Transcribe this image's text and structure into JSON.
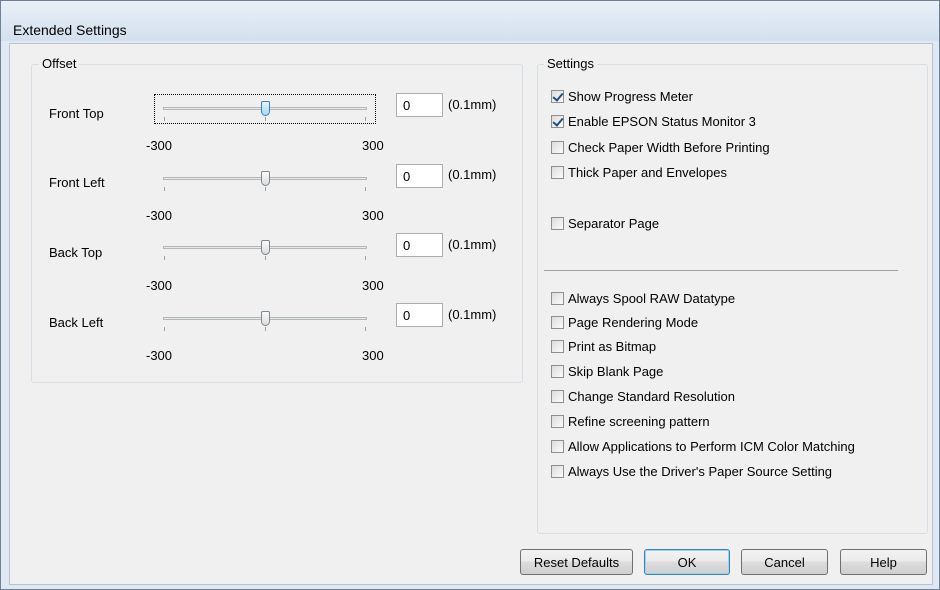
{
  "window": {
    "title": "Extended Settings"
  },
  "offset": {
    "legend": "Offset",
    "unit": "(0.1mm)",
    "min_label": "-300",
    "max_label": "300",
    "rows": [
      {
        "label": "Front Top",
        "value": "0"
      },
      {
        "label": "Front Left",
        "value": "0"
      },
      {
        "label": "Back Top",
        "value": "0"
      },
      {
        "label": "Back Left",
        "value": "0"
      }
    ]
  },
  "settings": {
    "legend": "Settings",
    "group1": [
      {
        "label": "Show Progress Meter",
        "checked": true
      },
      {
        "label": "Enable EPSON Status Monitor 3",
        "checked": true
      },
      {
        "label": "Check Paper Width Before Printing",
        "checked": false
      },
      {
        "label": "Thick Paper and Envelopes",
        "checked": false
      },
      {
        "label": "Separator Page",
        "checked": false
      }
    ],
    "group2": [
      {
        "label": "Always Spool RAW Datatype",
        "checked": false
      },
      {
        "label": "Page Rendering Mode",
        "checked": false
      },
      {
        "label": "Print as Bitmap",
        "checked": false
      },
      {
        "label": "Skip Blank Page",
        "checked": false
      },
      {
        "label": "Change Standard Resolution",
        "checked": false
      },
      {
        "label": "Refine screening pattern",
        "checked": false
      },
      {
        "label": "Allow Applications to Perform ICM Color Matching",
        "checked": false
      },
      {
        "label": "Always Use the Driver's Paper Source Setting",
        "checked": false
      }
    ]
  },
  "buttons": {
    "reset": "Reset Defaults",
    "ok": "OK",
    "cancel": "Cancel",
    "help": "Help"
  }
}
